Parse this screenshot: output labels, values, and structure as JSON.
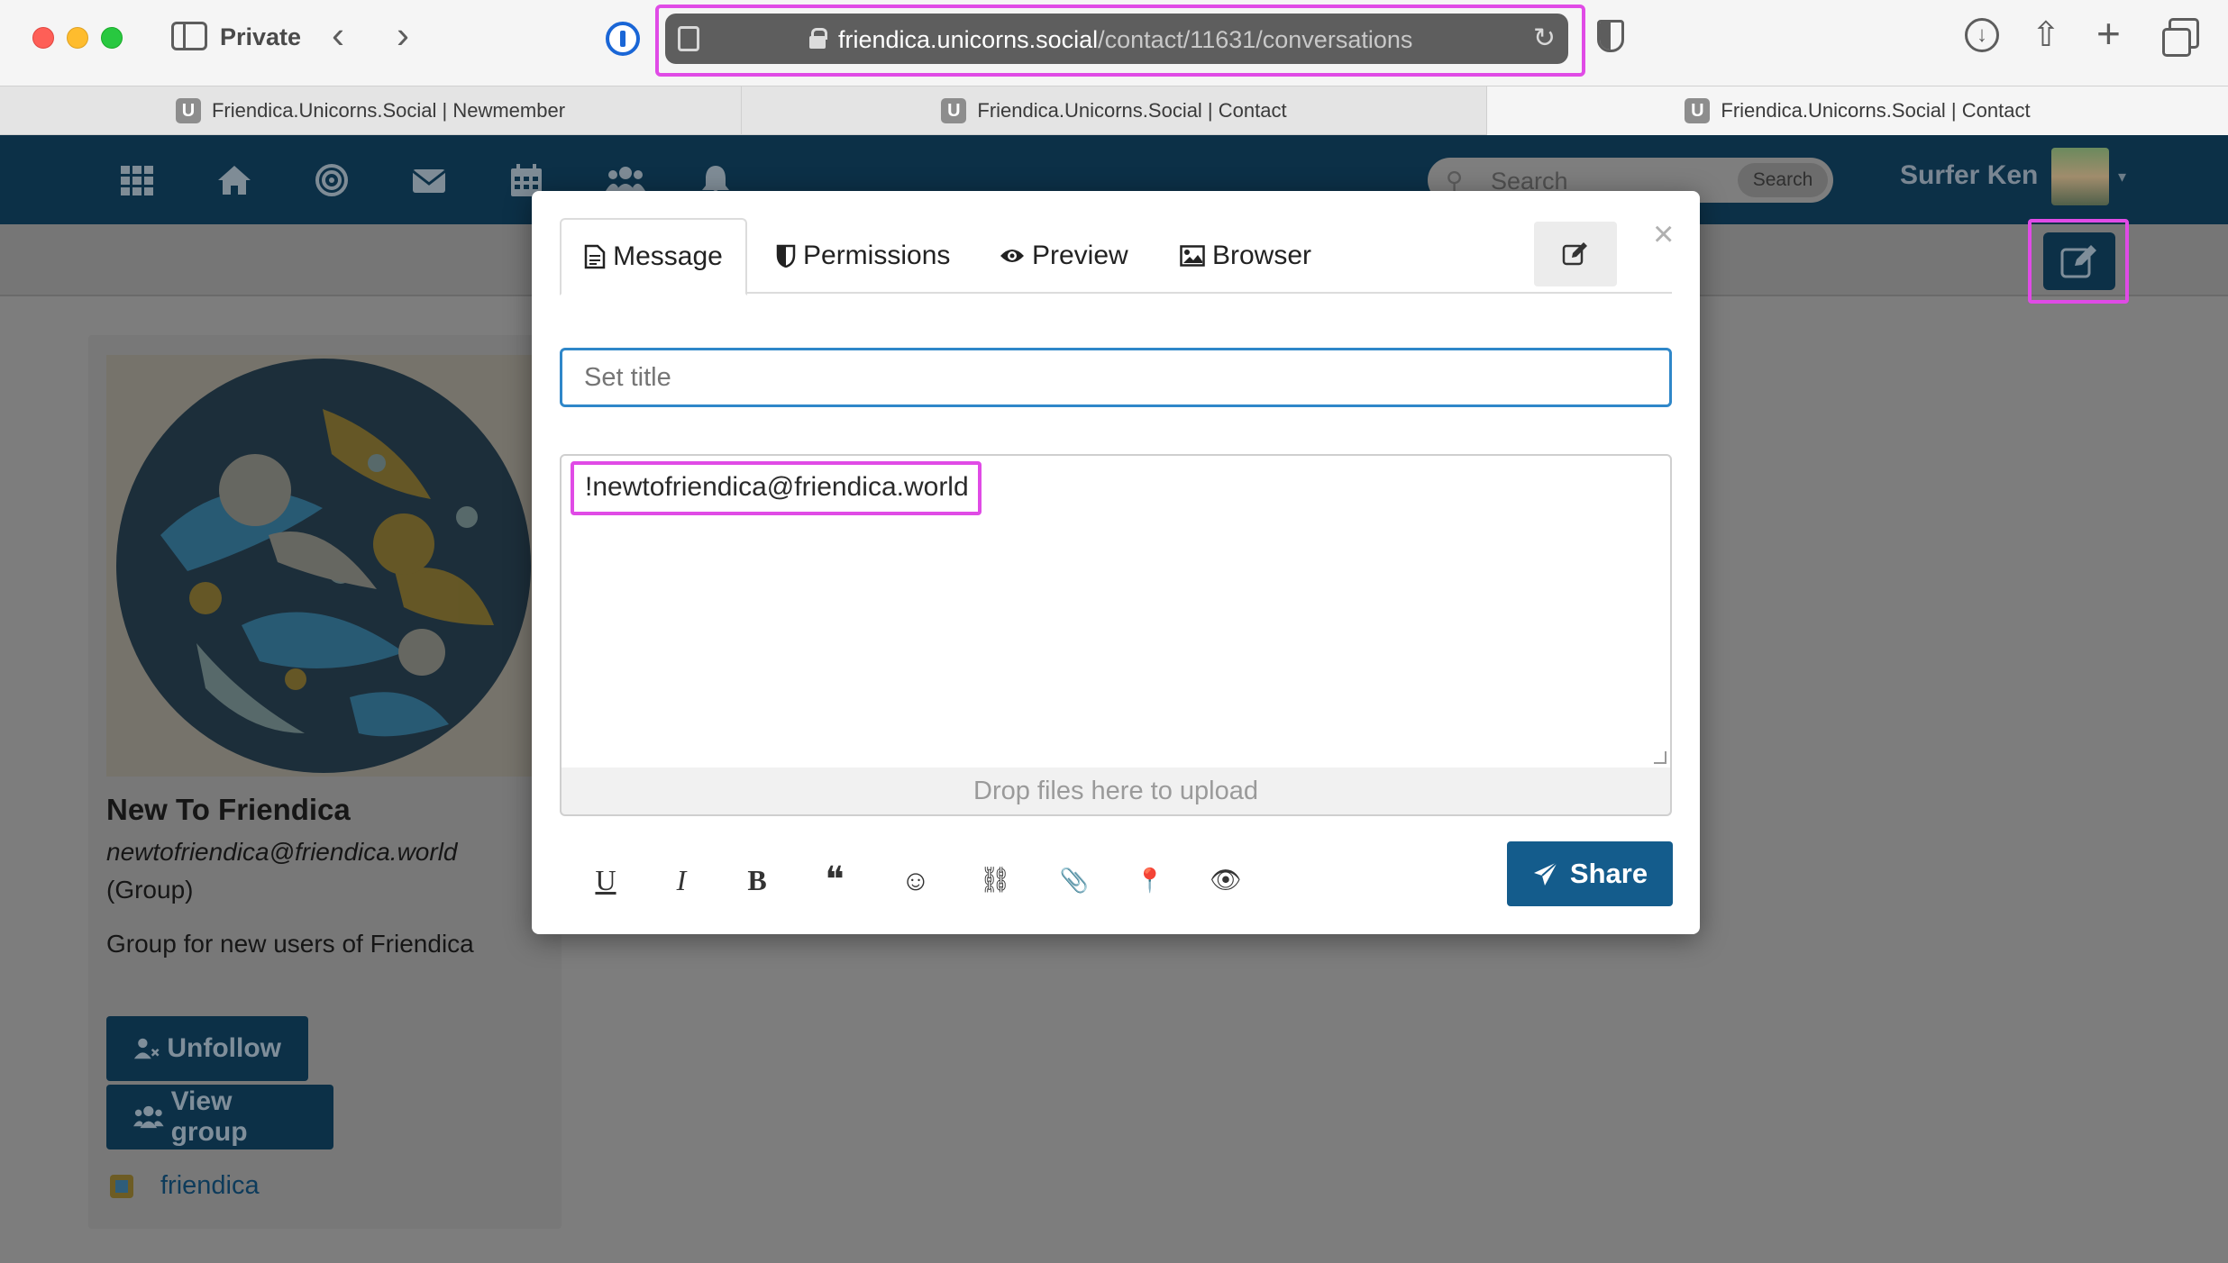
{
  "browser": {
    "private_label": "Private",
    "url_host": "friendica.unicorns.social",
    "url_path": "/contact/11631/conversations",
    "tabs": [
      {
        "favicon": "U",
        "title": "Friendica.Unicorns.Social | Newmember"
      },
      {
        "favicon": "U",
        "title": "Friendica.Unicorns.Social | Contact"
      },
      {
        "favicon": "U",
        "title": "Friendica.Unicorns.Social | Contact"
      }
    ]
  },
  "navbar": {
    "search_placeholder": "Search",
    "search_button": "Search",
    "user_name": "Surfer Ken"
  },
  "profile": {
    "name": "New To Friendica",
    "handle": "newtofriendica@friendica.world",
    "type": "(Group)",
    "description": "Group for new users of Friendica",
    "unfollow_label": "Unfollow",
    "view_group_label": "View group",
    "network_label": "friendica"
  },
  "modal": {
    "tabs": {
      "message": "Message",
      "permissions": "Permissions",
      "preview": "Preview",
      "browser": "Browser"
    },
    "close": "×",
    "title_placeholder": "Set title",
    "body_text": "!newtofriendica@friendica.world",
    "drop_zone": "Drop files here to upload",
    "format_buttons": {
      "underline": "U",
      "italic": "I",
      "bold": "B",
      "quote": "❝",
      "emoji": "☺",
      "link": "⛓",
      "attach": "📎",
      "location": "📍",
      "preview": "👁"
    },
    "share_label": "Share"
  },
  "colors": {
    "navbar": "#0c3047",
    "accent": "#2f87c9",
    "share_button": "#145c8c",
    "highlight": "#e04be6"
  },
  "icons": [
    "sidebar-icon",
    "back-icon",
    "forward-icon",
    "password-manager-icon",
    "lock-icon",
    "reload-icon",
    "shield-icon",
    "download-icon",
    "share-icon",
    "new-tab-icon",
    "tab-overview-icon",
    "apps-icon",
    "home-icon",
    "network-icon",
    "mail-icon",
    "calendar-icon",
    "contacts-icon",
    "bell-icon",
    "search-icon",
    "compose-icon",
    "message-tab-icon",
    "permissions-icon",
    "eye-icon",
    "image-icon",
    "edit-icon",
    "send-icon",
    "unfollow-icon",
    "group-icon"
  ]
}
